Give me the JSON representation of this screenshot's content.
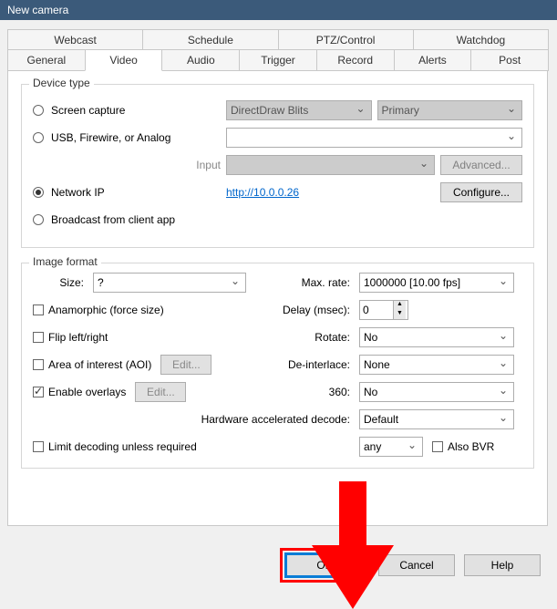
{
  "window": {
    "title": "New camera"
  },
  "tabs": {
    "row1": [
      "Webcast",
      "Schedule",
      "PTZ/Control",
      "Watchdog"
    ],
    "row2": [
      "General",
      "Video",
      "Audio",
      "Trigger",
      "Record",
      "Alerts",
      "Post"
    ],
    "selected": "Video"
  },
  "device_type": {
    "group_title": "Device type",
    "screen_capture": "Screen capture",
    "usb": "USB, Firewire, or Analog",
    "input_label": "Input",
    "advanced_btn": "Advanced...",
    "network_ip": "Network IP",
    "ip_link": "http://10.0.0.26",
    "configure_btn": "Configure...",
    "broadcast": "Broadcast from client app",
    "dd_blits": "DirectDraw Blits",
    "primary": "Primary"
  },
  "image_format": {
    "group_title": "Image format",
    "size_label": "Size:",
    "size_value": "?",
    "anamorphic": "Anamorphic (force size)",
    "flip": "Flip left/right",
    "aoi": "Area of interest (AOI)",
    "overlays": "Enable overlays",
    "edit_btn": "Edit...",
    "max_rate_label": "Max. rate:",
    "max_rate_value": "1000000 [10.00 fps]",
    "delay_label": "Delay (msec):",
    "delay_value": "0",
    "rotate_label": "Rotate:",
    "rotate_value": "No",
    "deinterlace_label": "De-interlace:",
    "deinterlace_value": "None",
    "three60_label": "360:",
    "three60_value": "No",
    "hw_label": "Hardware accelerated decode:",
    "hw_value": "Default",
    "limit": "Limit decoding unless required",
    "any": "any",
    "also_bvr": "Also BVR"
  },
  "buttons": {
    "ok": "OK",
    "cancel": "Cancel",
    "help": "Help"
  }
}
